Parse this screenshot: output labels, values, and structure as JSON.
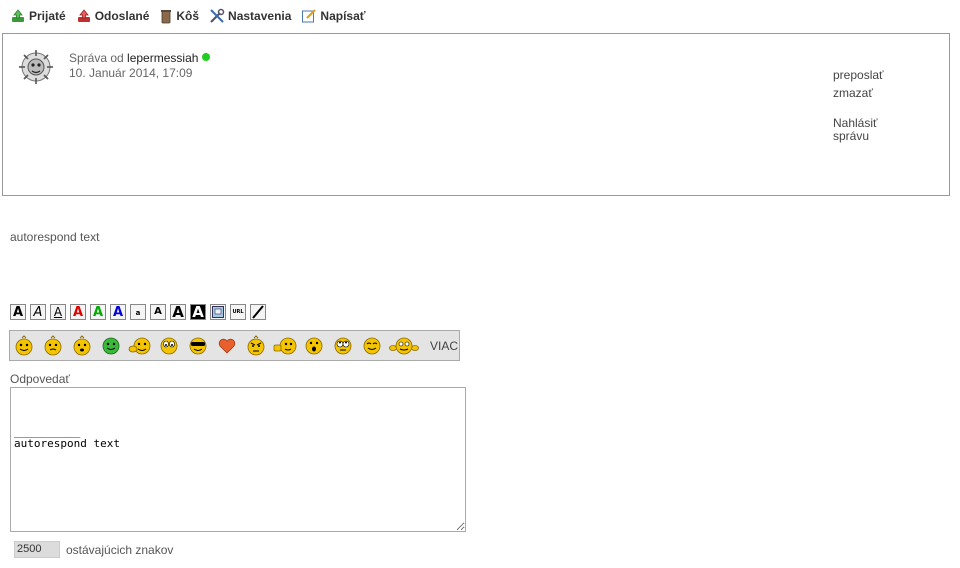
{
  "nav": {
    "inbox": "Prijaté",
    "sent": "Odoslané",
    "trash": "Kôš",
    "settings": "Nastavenia",
    "compose": "Napísať"
  },
  "message": {
    "from_prefix": "Správa od",
    "sender": "lepermessiah",
    "date": "10. Január 2014, 17:09",
    "actions": {
      "forward": "preposlať",
      "delete": "zmazať",
      "report_line1": "Nahlásiť",
      "report_line2": "správu"
    },
    "body": "autorespond text"
  },
  "format_buttons": [
    "A",
    "A",
    "A",
    "A",
    "A",
    "A",
    "a",
    "A",
    "A",
    "A",
    "",
    "URL",
    ""
  ],
  "smileys_more": "VIAC",
  "reply": {
    "label": "Odpovedať",
    "value": "\n\n\n__________\nautorespond text",
    "remaining_value": "2500",
    "remaining_label": "ostávajúcich znakov"
  },
  "colors": {
    "online": "#22cc22",
    "fmt_red": "#e00000",
    "fmt_green": "#00aa00",
    "fmt_blue": "#0000dd",
    "smiley_yellow": "#f4c400",
    "heart": "#e8602c"
  }
}
